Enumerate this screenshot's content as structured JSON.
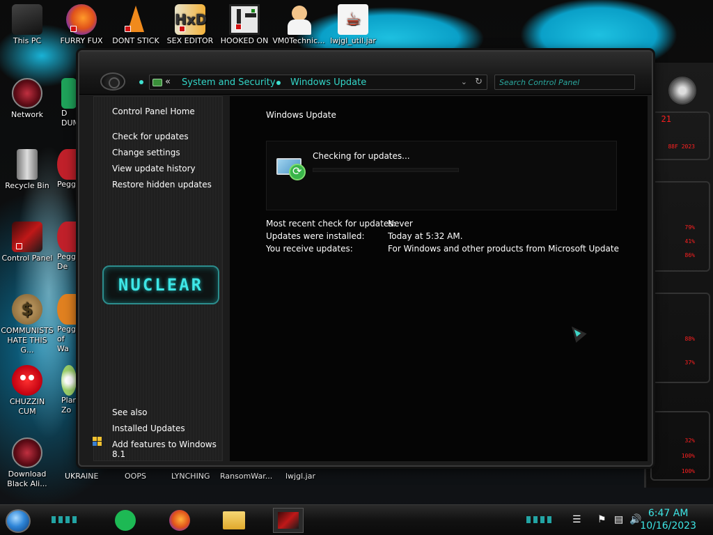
{
  "desktop": {
    "top_icons": [
      {
        "label": "This PC"
      },
      {
        "label": "FURRY FUX"
      },
      {
        "label": "DONT STICK"
      },
      {
        "label": "SEX EDITOR"
      },
      {
        "label": "HOOKED ON"
      },
      {
        "label": "VM0Technic..."
      },
      {
        "label": "lwjgl_util.jar"
      }
    ],
    "left_icons": [
      {
        "label": "Network"
      },
      {
        "label": "Recycle Bin"
      },
      {
        "label": "Control Panel"
      },
      {
        "label": "COMMUNISTS HATE THIS G..."
      },
      {
        "label": "CHUZZIN CUM"
      },
      {
        "label": "Download Black Ali..."
      }
    ],
    "second_column": [
      {
        "label": "D DUM"
      },
      {
        "label": "Peggle"
      },
      {
        "label": "Peggle De"
      },
      {
        "label": "Peggle of Wa"
      },
      {
        "label": "Plan Zo"
      }
    ],
    "bottom_labels": [
      {
        "label": "UKRAINE"
      },
      {
        "label": "OOPS"
      },
      {
        "label": "LYNCHING"
      },
      {
        "label": "RansomWar..."
      },
      {
        "label": "lwjgl.jar"
      }
    ],
    "widget_stats": [
      "21",
      "88F 2023",
      "79%",
      "41%",
      "86%",
      "88%",
      "37%",
      "32%",
      "100%",
      "100%"
    ]
  },
  "window": {
    "breadcrumb": {
      "parent": "System and Security",
      "current": "Windows Update",
      "back_glyph": "«"
    },
    "search": {
      "placeholder": "Search Control Panel"
    },
    "left_pane": {
      "home_link": "Control Panel Home",
      "links": [
        "Check for updates",
        "Change settings",
        "View update history",
        "Restore hidden updates"
      ],
      "brand_logo": "NUCLEAR",
      "see_also_heading": "See also",
      "see_also_links": [
        "Installed Updates",
        "Add features to Windows 8.1"
      ]
    },
    "content": {
      "heading": "Windows Update",
      "status": "Checking for updates...",
      "progress": 0.0,
      "info": [
        {
          "key": "Most recent check for updates:",
          "value": "Never"
        },
        {
          "key": "Updates were installed:",
          "value": "Today at 5:32 AM."
        },
        {
          "key": "You receive updates:",
          "value": "For Windows and other products from Microsoft Update"
        }
      ]
    }
  },
  "taskbar": {
    "apps": [
      {
        "name": "spotify-icon"
      },
      {
        "name": "firefox-icon"
      },
      {
        "name": "file-explorer-icon"
      },
      {
        "name": "control-panel-icon"
      }
    ],
    "clock": {
      "time": "6:47 AM",
      "date": "10/16/2023"
    }
  },
  "colors": {
    "accent": "#33d6c8",
    "alert": "#ff2020",
    "window_bg": "#050505"
  }
}
